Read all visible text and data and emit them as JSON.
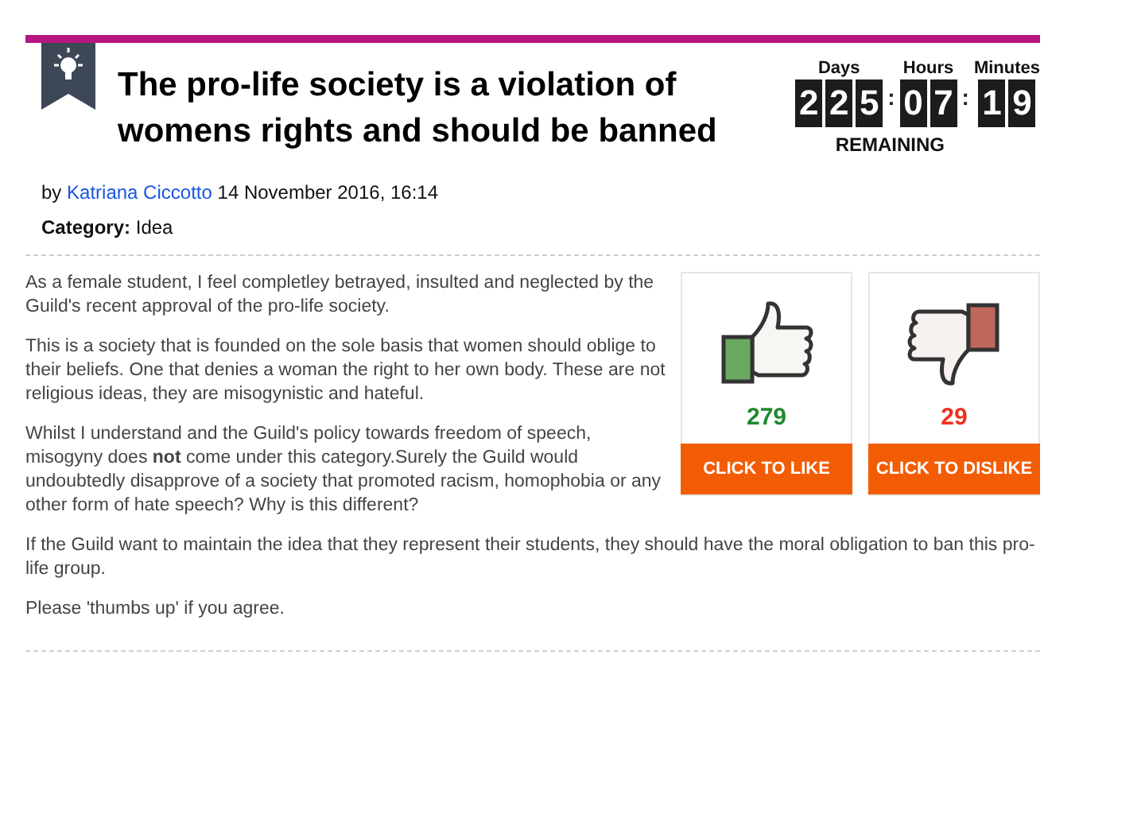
{
  "title": "The pro-life society is a violation of womens rights and should be banned",
  "countdown": {
    "units": [
      {
        "label": "Days",
        "digits": "225"
      },
      {
        "label": "Hours",
        "digits": "07"
      },
      {
        "label": "Minutes",
        "digits": "19"
      }
    ],
    "separators": [
      ":",
      ":"
    ],
    "caption": "REMAINING"
  },
  "byline": {
    "prefix": "by",
    "author": "Katriana Ciccotto",
    "date": "14 November 2016, 16:14"
  },
  "category": {
    "label": "Category:",
    "value": "Idea"
  },
  "paragraphs": [
    "As a female student, I feel completley betrayed, insulted and neglected by the Guild's recent approval of the pro-life society.",
    "This is a society that is founded on the sole basis that women should oblige to their beliefs. One that denies a woman the right to her own body. These are not religious ideas, they are misogynistic and hateful.",
    "Whilst I understand and the Guild's policy towards freedom of speech, misogyny does **not** come under this category.Surely the Guild would undoubtedly disapprove of a society that promoted racism, homophobia or any other form of hate speech? Why is this different?",
    "If the Guild want to maintain the idea that they represent their students, they should have the moral obligation to ban this pro-life group.",
    "Please 'thumbs up' if you agree."
  ],
  "votes": [
    {
      "kind": "like",
      "count": "279",
      "button": "CLICK TO LIKE"
    },
    {
      "kind": "dislike",
      "count": "29",
      "button": "CLICK TO DISLIKE"
    }
  ]
}
